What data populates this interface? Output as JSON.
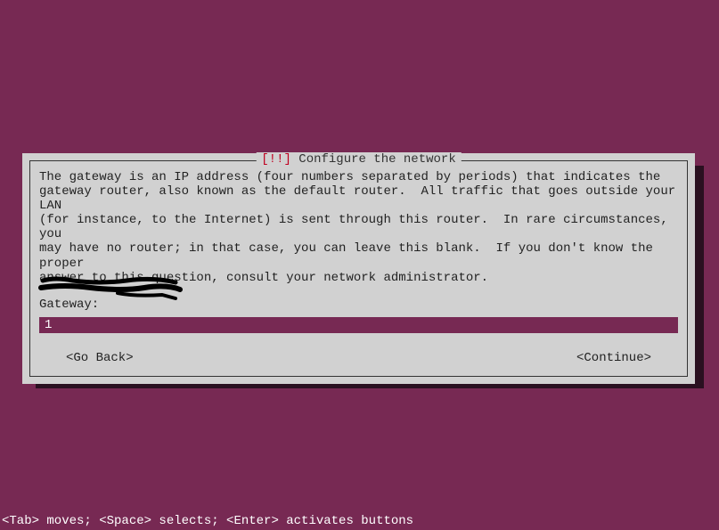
{
  "dialog": {
    "title_prefix": "[!!]",
    "title_text": "Configure the network",
    "description": "The gateway is an IP address (four numbers separated by periods) that indicates the\ngateway router, also known as the default router.  All traffic that goes outside your LAN\n(for instance, to the Internet) is sent through this router.  In rare circumstances, you\nmay have no router; in that case, you can leave this blank.  If you don't know the proper\nanswer to this question, consult your network administrator.",
    "field_label": "Gateway:",
    "input_value": "1",
    "go_back_label": "<Go Back>",
    "continue_label": "<Continue>"
  },
  "help_bar": "<Tab> moves; <Space> selects; <Enter> activates buttons"
}
